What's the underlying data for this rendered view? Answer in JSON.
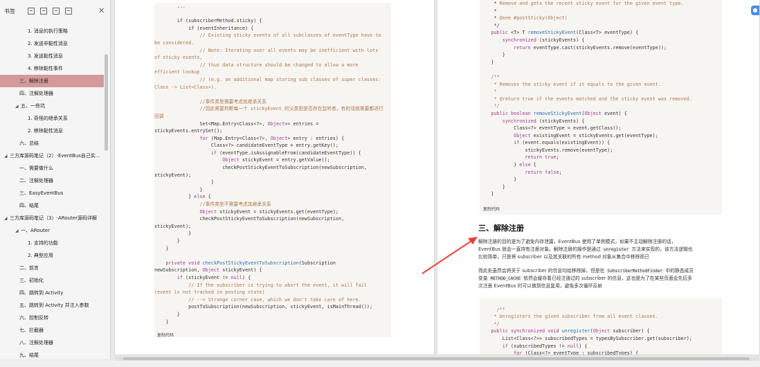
{
  "sidebar": {
    "title": "书签",
    "items": [
      {
        "label": "1. 消息的执行策略",
        "indent": 40
      },
      {
        "label": "2. 发送非黏性消息",
        "indent": 40
      },
      {
        "label": "3. 发送黏性消息",
        "indent": 40
      },
      {
        "label": "4. 移除黏性事件",
        "indent": 40
      },
      {
        "label": "三、解除注册",
        "indent": 28,
        "selected": true
      },
      {
        "label": "四、注解处理器",
        "indent": 28
      },
      {
        "label": "五、一些坑",
        "indent": 22,
        "expanded": true
      },
      {
        "label": "1. 奇怪的继承关系",
        "indent": 40
      },
      {
        "label": "2. 移除黏性消息",
        "indent": 40
      },
      {
        "label": "六、总结",
        "indent": 28
      },
      {
        "label": "三方库源码笔记（2）-EventBus自己实...",
        "indent": 6,
        "expanded": true
      },
      {
        "label": "一、需要做什么",
        "indent": 28
      },
      {
        "label": "二、注解处理器",
        "indent": 28
      },
      {
        "label": "三、EasyEventBus",
        "indent": 28
      },
      {
        "label": "四、结尾",
        "indent": 28
      },
      {
        "label": "三方库源码笔记（3）-ARouter源码详解",
        "indent": 6,
        "expanded": true
      },
      {
        "label": "一、ARouter",
        "indent": 22,
        "expanded": true
      },
      {
        "label": "1. 支持的功能",
        "indent": 40
      },
      {
        "label": "2. 典型应用",
        "indent": 40
      },
      {
        "label": "二、前言",
        "indent": 28
      },
      {
        "label": "三、初始化",
        "indent": 28
      },
      {
        "label": "四、跳转到 Activity",
        "indent": 28
      },
      {
        "label": "五、跳转到 Activity 并注入参数",
        "indent": 28
      },
      {
        "label": "六、控制反转",
        "indent": 28
      },
      {
        "label": "七、拦截器",
        "indent": 28
      },
      {
        "label": "八、注解处理器",
        "indent": 28
      },
      {
        "label": "九、结尾",
        "indent": 28
      }
    ]
  },
  "left_page": {
    "copy_label": "复制代码"
  },
  "right_page": {
    "copy_label": "复制代码",
    "heading": "三、解除注册",
    "para1_a": "解除注册的目的是为了避免内存泄露，EventBus 使用了单例模式，如果不主动解除注册的话，",
    "para1_b": "EventBus 就会一直持有注册对象。解除注册的操作是通过",
    "para1_code": "unregister",
    "para1_c": "方法来实现的，该方法逻辑也",
    "para1_d": "比较简单，只是将 subscriber 以及其关联的所有 method 对象从集合中移除而已",
    "para2_a": "而此处虽然会将关于 subscriber 的信息均给移除掉，但是在",
    "para2_code": "SubscriberMethodFinder",
    "para2_b": "中的静态成员",
    "para2_c": "变量",
    "para2_code2": "METHOD_CACHE",
    "para2_d": "依然会缓存着已经注册过的 subscriber 的信息，这也是为了在某些页面会先后多",
    "para2_e": "次注册 EventBus 时可以做到信息复用，避免多次循环反射"
  },
  "colors": {
    "accent": "#e8413c",
    "selected_item": "#d49a9a",
    "keyword": "#a2398f",
    "comment": "#b0784a",
    "string_blue": "#2d6fa8"
  }
}
